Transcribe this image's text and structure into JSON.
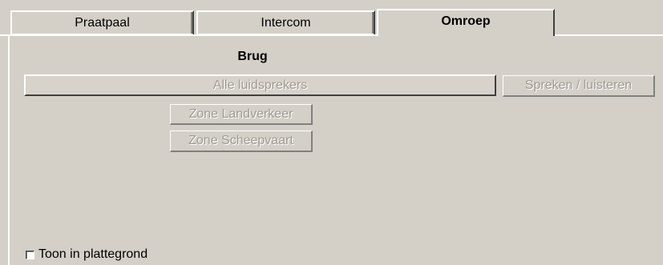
{
  "tabs": [
    {
      "label": "Praatpaal",
      "active": false
    },
    {
      "label": "Intercom",
      "active": false
    },
    {
      "label": "Omroep",
      "active": true
    }
  ],
  "panel": {
    "title": "Brug",
    "all_speakers_label": "Alle luidsprekers",
    "speak_listen_label": "Spreken / luisteren",
    "zone_land_label": "Zone Landverkeer",
    "zone_ship_label": "Zone Scheepvaart"
  },
  "footer": {
    "show_in_floorplan_label": "Toon in plattegrond",
    "show_in_floorplan_checked": false
  },
  "colors": {
    "background": "#d4d0c8",
    "disabled_text": "#a09c94",
    "text": "#000000"
  }
}
